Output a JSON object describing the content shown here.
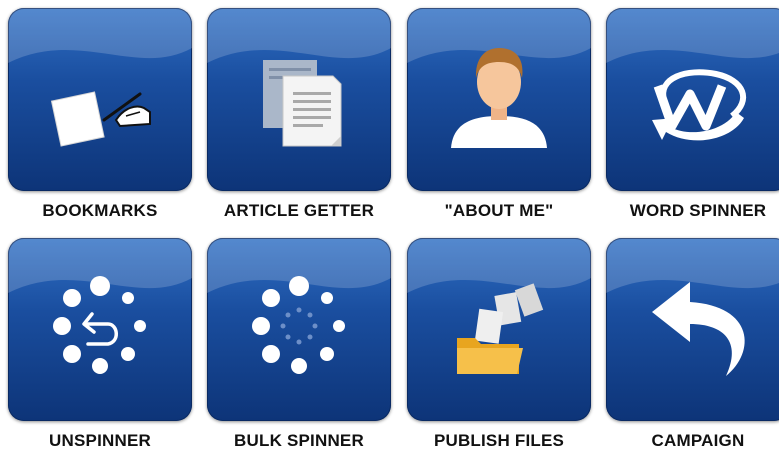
{
  "colors": {
    "tile_top": "#2f6fc4",
    "tile_bottom": "#0d3478",
    "caption": "#111111"
  },
  "tiles": [
    {
      "label": "BOOKMARKS",
      "icon": "bookmark-page-hand-icon"
    },
    {
      "label": "ARTICLE GETTER",
      "icon": "documents-icon"
    },
    {
      "label": "\"ABOUT ME\"",
      "icon": "user-profile-icon"
    },
    {
      "label": "WORD SPINNER",
      "icon": "w-spin-arrow-icon"
    },
    {
      "label": "UNSPINNER",
      "icon": "undo-spinner-icon"
    },
    {
      "label": "BULK SPINNER",
      "icon": "loading-spinner-icon"
    },
    {
      "label": "PUBLISH FILES",
      "icon": "folder-flying-papers-icon"
    },
    {
      "label": "CAMPAIGN",
      "icon": "curved-back-arrow-icon"
    }
  ]
}
